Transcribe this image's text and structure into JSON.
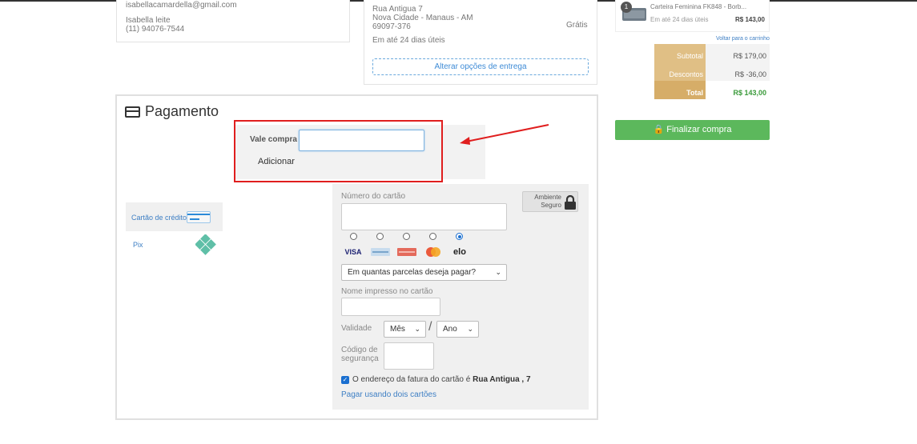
{
  "customer": {
    "email": "isabellacamardella@gmail.com",
    "name": "Isabella leite",
    "phone": "(11) 94076-7544"
  },
  "delivery": {
    "street": "Rua Antigua 7",
    "city": "Nova Cidade - Manaus - AM",
    "zip": "69097-376",
    "eta": "Em até 24 dias úteis",
    "price": "Grátis",
    "change_button": "Alterar opções de entrega"
  },
  "payment": {
    "title": "Pagamento",
    "voucher": {
      "label": "Vale compra",
      "value": "",
      "add_button": "Adicionar"
    },
    "methods": [
      {
        "label": "Cartão de crédito",
        "active": true
      },
      {
        "label": "Pix",
        "active": false
      }
    ],
    "card_form": {
      "number_label": "Número do cartão",
      "number_value": "",
      "secure_badge": [
        "Ambiente",
        "Seguro"
      ],
      "brands": [
        "VISA",
        "AMEX",
        "Diners",
        "Mastercard",
        "elo"
      ],
      "selected_brand": "elo",
      "installments_placeholder": "Em quantas parcelas deseja pagar?",
      "name_label": "Nome impresso no cartão",
      "name_value": "",
      "validity_label": "Validade",
      "month_placeholder": "Mês",
      "year_placeholder": "Ano",
      "separator": "/",
      "cvv_label": [
        "Código de",
        "segurança"
      ],
      "billing_address_prefix": "O endereço da fatura do cartão é",
      "billing_address": "Rua Antigua , 7",
      "billing_checked": true,
      "two_cards_link": "Pagar usando dois cartões"
    }
  },
  "summary": {
    "product": {
      "quantity": "1",
      "name": "Carteira Feminina FK848 - Borb...",
      "eta": "Em até 24 dias úteis",
      "price": "R$ 143,00"
    },
    "back_link": "Voltar para o carrinho",
    "rows": [
      {
        "label": "Subtotal",
        "value": "R$ 179,00"
      },
      {
        "label": "Descontos",
        "value": "R$ -36,00"
      },
      {
        "label": "Total",
        "value": "R$ 143,00"
      }
    ],
    "finish_button": "Finalizar compra"
  },
  "colors": {
    "link": "#3e7fc4",
    "highlight": "#e01e1e",
    "finish": "#5cb85c",
    "summary_label": "#e0bf85",
    "total_value": "#3a9a3a"
  }
}
